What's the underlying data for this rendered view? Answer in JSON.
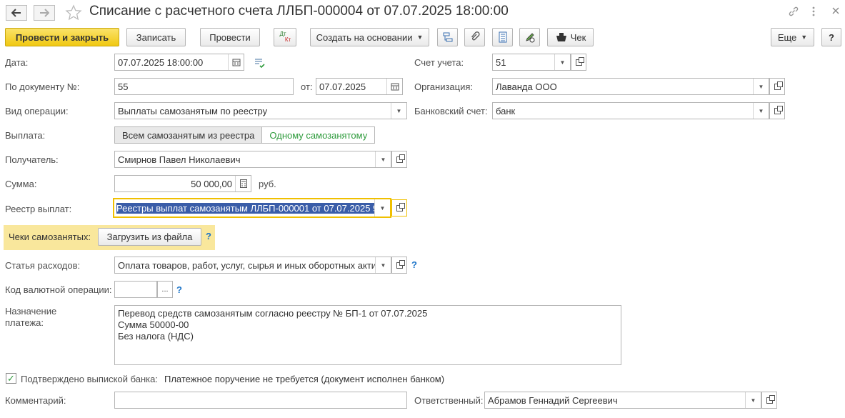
{
  "window": {
    "title": "Списание с расчетного счета ЛЛБП-000004 от 07.07.2025 18:00:00",
    "back_icon": "arrow-left-icon",
    "forward_icon": "arrow-right-icon",
    "favorite_icon": "star-icon"
  },
  "toolbar": {
    "post_and_close": "Провести и закрыть",
    "save": "Записать",
    "post": "Провести",
    "dtkt_top": "Дт",
    "dtkt_bottom": "Кт",
    "create_based_on": "Создать на основании",
    "check": "Чек",
    "more": "Еще",
    "help": "?"
  },
  "form": {
    "date": {
      "label": "Дата:",
      "value": "07.07.2025 18:00:00"
    },
    "doc_number": {
      "label": "По документу №:",
      "value": "55",
      "from_label": "от:",
      "from_value": "07.07.2025"
    },
    "operation_type": {
      "label": "Вид операции:",
      "value": "Выплаты самозанятым по реестру"
    },
    "payout": {
      "label": "Выплата:",
      "option_all": "Всем самозанятым из реестра",
      "option_one": "Одному самозанятому"
    },
    "recipient": {
      "label": "Получатель:",
      "value": "Смирнов Павел Николаевич"
    },
    "amount": {
      "label": "Сумма:",
      "value": "50 000,00",
      "currency": "руб."
    },
    "registry": {
      "label": "Реестр выплат:",
      "value": "Реестры выплат самозанятым ЛЛБП-000001 от 07.07.2025 9"
    },
    "receipts": {
      "label": "Чеки самозанятых:",
      "load_button": "Загрузить из файла",
      "help": "?"
    },
    "expense_item": {
      "label": "Статья расходов:",
      "value": "Оплата товаров, работ, услуг, сырья и иных оборотных активов",
      "help": "?"
    },
    "currency_op_code": {
      "label": "Код валютной операции:",
      "value": "",
      "select_button": "...",
      "help": "?"
    },
    "purpose": {
      "label_line1": "Назначение",
      "label_line2": "платежа:",
      "value": "Перевод средств самозанятым согласно реестру № БП-1 от 07.07.2025\nСумма 50000-00\nБез налога (НДС)"
    },
    "bank_confirmed": {
      "label": "Подтверждено выпиской банка:",
      "checked": true,
      "note": "Платежное поручение не требуется (документ исполнен банком)"
    },
    "comment": {
      "label": "Комментарий:",
      "value": ""
    },
    "account": {
      "label": "Счет учета:",
      "value": "51"
    },
    "organization": {
      "label": "Организация:",
      "value": "Лаванда ООО"
    },
    "bank_account": {
      "label": "Банковский счет:",
      "value": "банк"
    },
    "responsible": {
      "label": "Ответственный:",
      "value": "Абрамов Геннадий Сергеевич"
    }
  },
  "colors": {
    "primary_button": "#f0c812",
    "highlight_band": "#f9e79c",
    "focus_border": "#f0c000",
    "selection": "#3a5da8",
    "toggle_active": "#2e9b3c",
    "help": "#1a73c8"
  }
}
